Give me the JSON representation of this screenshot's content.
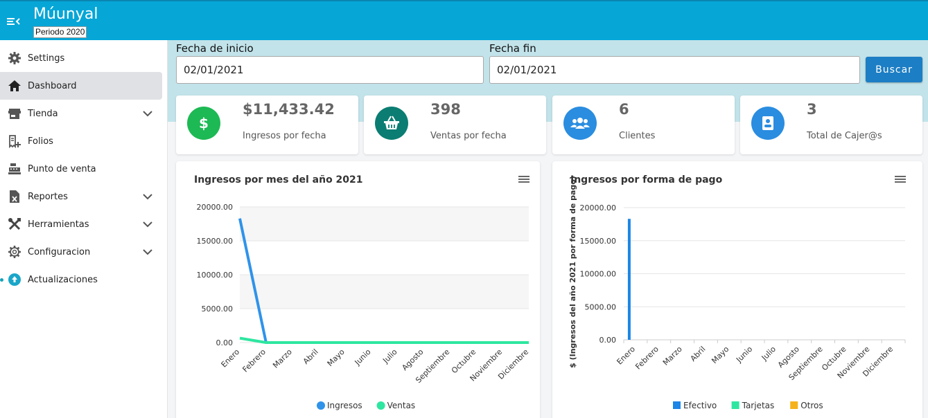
{
  "header": {
    "app_title": "Múunyal",
    "period": "Periodo 2020"
  },
  "sidebar": {
    "items": [
      {
        "label": "Settings",
        "icon": "gear-icon"
      },
      {
        "label": "Dashboard",
        "icon": "home-icon",
        "active": true
      },
      {
        "label": "Tienda",
        "icon": "store-icon",
        "expandable": true
      },
      {
        "label": "Folios",
        "icon": "receipt-icon"
      },
      {
        "label": "Punto de venta",
        "icon": "cash-register-icon"
      },
      {
        "label": "Reportes",
        "icon": "excel-file-icon",
        "expandable": true
      },
      {
        "label": "Herramientas",
        "icon": "tools-icon",
        "expandable": true
      },
      {
        "label": "Configuracion",
        "icon": "cog-outline-icon",
        "expandable": true
      },
      {
        "label": "Actualizaciones",
        "icon": "upload-circle-icon"
      }
    ]
  },
  "filters": {
    "start_label": "Fecha de inicio",
    "start_value": "02/01/2021",
    "end_label": "Fecha fin",
    "end_value": "02/01/2021",
    "search_label": "Buscar"
  },
  "cards": [
    {
      "value": "$11,433.42",
      "label": "Ingresos por fecha",
      "icon": "dollar-icon",
      "color": "#1db954"
    },
    {
      "value": "398",
      "label": "Ventas por fecha",
      "icon": "basket-icon",
      "color": "#0b7d72"
    },
    {
      "value": "6",
      "label": "Clientes",
      "icon": "users-icon",
      "color": "#2a8de0"
    },
    {
      "value": "3",
      "label": "Total de Cajer@s",
      "icon": "cashier-badge-icon",
      "color": "#2a8de0"
    }
  ],
  "colors": {
    "accent": "#06a6d7",
    "button": "#1c7ec4",
    "ingresos": "#2f93ea",
    "ventas": "#2ee6a0",
    "efectivo": "#1b86e6",
    "tarjetas": "#2ee6a0",
    "otros": "#f6b21a"
  },
  "chart_data": [
    {
      "type": "line",
      "title": "Ingresos por mes del año 2021",
      "categories": [
        "Enero",
        "Febrero",
        "Marzo",
        "Abril",
        "Mayo",
        "Junio",
        "Julio",
        "Agosto",
        "Septiembre",
        "Octubre",
        "Noviembre",
        "Diciembre"
      ],
      "series": [
        {
          "name": "Ingresos",
          "values": [
            18300,
            0,
            0,
            0,
            0,
            0,
            0,
            0,
            0,
            0,
            0,
            0
          ]
        },
        {
          "name": "Ventas",
          "values": [
            650,
            0,
            0,
            0,
            0,
            0,
            0,
            0,
            0,
            0,
            0,
            0
          ]
        }
      ],
      "yticks": [
        "20000.00",
        "15000.00",
        "10000.00",
        "5000.00",
        "0.00"
      ],
      "ylim": [
        0,
        20000
      ],
      "legend": "bottom",
      "grid": "alternating bands"
    },
    {
      "type": "bar",
      "title": "Ingresos por forma de pago",
      "ylabel": "$ (Ingresos del año 2021 por forma de pago)",
      "categories": [
        "Enero",
        "Febrero",
        "Marzo",
        "Abril",
        "Mayo",
        "Junio",
        "Julio",
        "Agosto",
        "Septiembre",
        "Octubre",
        "Noviembre",
        "Diciembre"
      ],
      "series": [
        {
          "name": "Efectivo",
          "values": [
            18300,
            0,
            0,
            0,
            0,
            0,
            0,
            0,
            0,
            0,
            0,
            0
          ]
        },
        {
          "name": "Tarjetas",
          "values": [
            0,
            0,
            0,
            0,
            0,
            0,
            0,
            0,
            0,
            0,
            0,
            0
          ]
        },
        {
          "name": "Otros",
          "values": [
            0,
            0,
            0,
            0,
            0,
            0,
            0,
            0,
            0,
            0,
            0,
            0
          ]
        }
      ],
      "yticks": [
        "20000.00",
        "15000.00",
        "10000.00",
        "5000.00",
        "0.00"
      ],
      "ylim": [
        0,
        20000
      ],
      "legend": "bottom",
      "grid": "horizontal lines"
    }
  ]
}
